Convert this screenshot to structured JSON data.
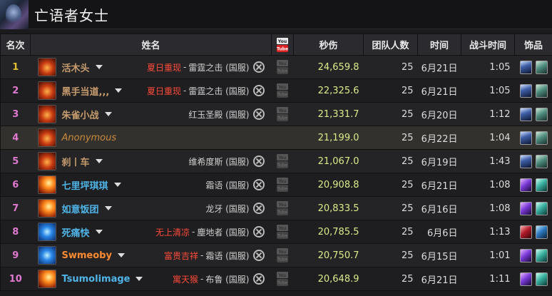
{
  "page": {
    "title": "亡语者女士"
  },
  "table": {
    "headers": {
      "rank": "名次",
      "name": "姓名",
      "dps": "秒伤",
      "team": "团队人数",
      "date": "时间",
      "fight_time": "战斗时间",
      "gear": "饰品"
    },
    "rows": [
      {
        "rank": "1",
        "rank_color": "#e0c030",
        "name": "活木头",
        "name_color": "#c69b6d",
        "class_icon": "warrior",
        "guild": "夏日重现",
        "server": "雷霆之击 (国服)",
        "dps": "24,659.8",
        "team": "25",
        "date": "6月21日",
        "fight_time": "1:05",
        "gear": [
          "g-a",
          "g-b"
        ],
        "highlight": false
      },
      {
        "rank": "2",
        "rank_color": "#e07ad0",
        "name": "黑手当道,,,",
        "name_color": "#c69b6d",
        "class_icon": "warrior",
        "guild": "夏日重现",
        "server": "雷霆之击 (国服)",
        "dps": "22,325.6",
        "team": "25",
        "date": "6月21日",
        "fight_time": "1:05",
        "gear": [
          "g-a",
          "g-b"
        ],
        "highlight": false
      },
      {
        "rank": "3",
        "rank_color": "#e07ad0",
        "name": "朱雀小战",
        "name_color": "#c69b6d",
        "class_icon": "warrior",
        "guild": "",
        "server": "红玉圣殿 (国服)",
        "dps": "21,331.7",
        "team": "25",
        "date": "6月20日",
        "fight_time": "1:12",
        "gear": [
          "g-a",
          "g-b"
        ],
        "highlight": false
      },
      {
        "rank": "4",
        "rank_color": "#e07ad0",
        "name": "Anonymous",
        "name_color": "#c88a3a",
        "class_icon": "warrior",
        "guild": "",
        "server": "",
        "dps": "21,199.0",
        "team": "25",
        "date": "6月22日",
        "fight_time": "1:04",
        "gear": [
          "g-a",
          "g-b"
        ],
        "highlight": true,
        "anonymous": true
      },
      {
        "rank": "5",
        "rank_color": "#e07ad0",
        "name": "刹丨车",
        "name_color": "#c69b6d",
        "class_icon": "warrior",
        "guild": "",
        "server": "维希度斯 (国服)",
        "dps": "21,067.0",
        "team": "25",
        "date": "6月19日",
        "fight_time": "1:43",
        "gear": [
          "g-a",
          "g-b"
        ],
        "highlight": false
      },
      {
        "rank": "6",
        "rank_color": "#e07ad0",
        "name": "七里坪琪琪",
        "name_color": "#4fb5e8",
        "class_icon": "fire",
        "guild": "",
        "server": "霜语 (国服)",
        "dps": "20,908.8",
        "team": "25",
        "date": "6月21日",
        "fight_time": "1:08",
        "gear": [
          "g-c",
          "g-d"
        ],
        "highlight": false
      },
      {
        "rank": "7",
        "rank_color": "#e07ad0",
        "name": "如意饭团",
        "name_color": "#4fb5e8",
        "class_icon": "fire",
        "guild": "",
        "server": "龙牙 (国服)",
        "dps": "20,833.5",
        "team": "25",
        "date": "6月16日",
        "fight_time": "1:08",
        "gear": [
          "g-c",
          "g-d"
        ],
        "highlight": false
      },
      {
        "rank": "8",
        "rank_color": "#e07ad0",
        "name": "死痛快",
        "name_color": "#4fb5e8",
        "class_icon": "frost",
        "guild": "无上清凉",
        "server": "塵地者 (国服)",
        "dps": "20,785.5",
        "team": "25",
        "date": "6月6日",
        "fight_time": "1:13",
        "gear": [
          "g-e",
          "g-f"
        ],
        "highlight": false
      },
      {
        "rank": "9",
        "rank_color": "#e07ad0",
        "name": "Swmeoby",
        "name_color": "#ff8a30",
        "class_icon": "frost",
        "guild": "富贵吉祥",
        "server": "霜语 (国服)",
        "dps": "20,750.7",
        "team": "25",
        "date": "6月15日",
        "fight_time": "1:01",
        "gear": [
          "g-c",
          "g-d"
        ],
        "highlight": false
      },
      {
        "rank": "10",
        "rank_color": "#e07ad0",
        "name": "Tsumolimage",
        "name_color": "#4fb5e8",
        "class_icon": "fire",
        "guild": "寓天猴",
        "server": "布鲁 (国服)",
        "dps": "20,648.9",
        "team": "25",
        "date": "6月21日",
        "fight_time": "1:11",
        "gear": [
          "g-c",
          "g-d"
        ],
        "highlight": false
      }
    ]
  }
}
